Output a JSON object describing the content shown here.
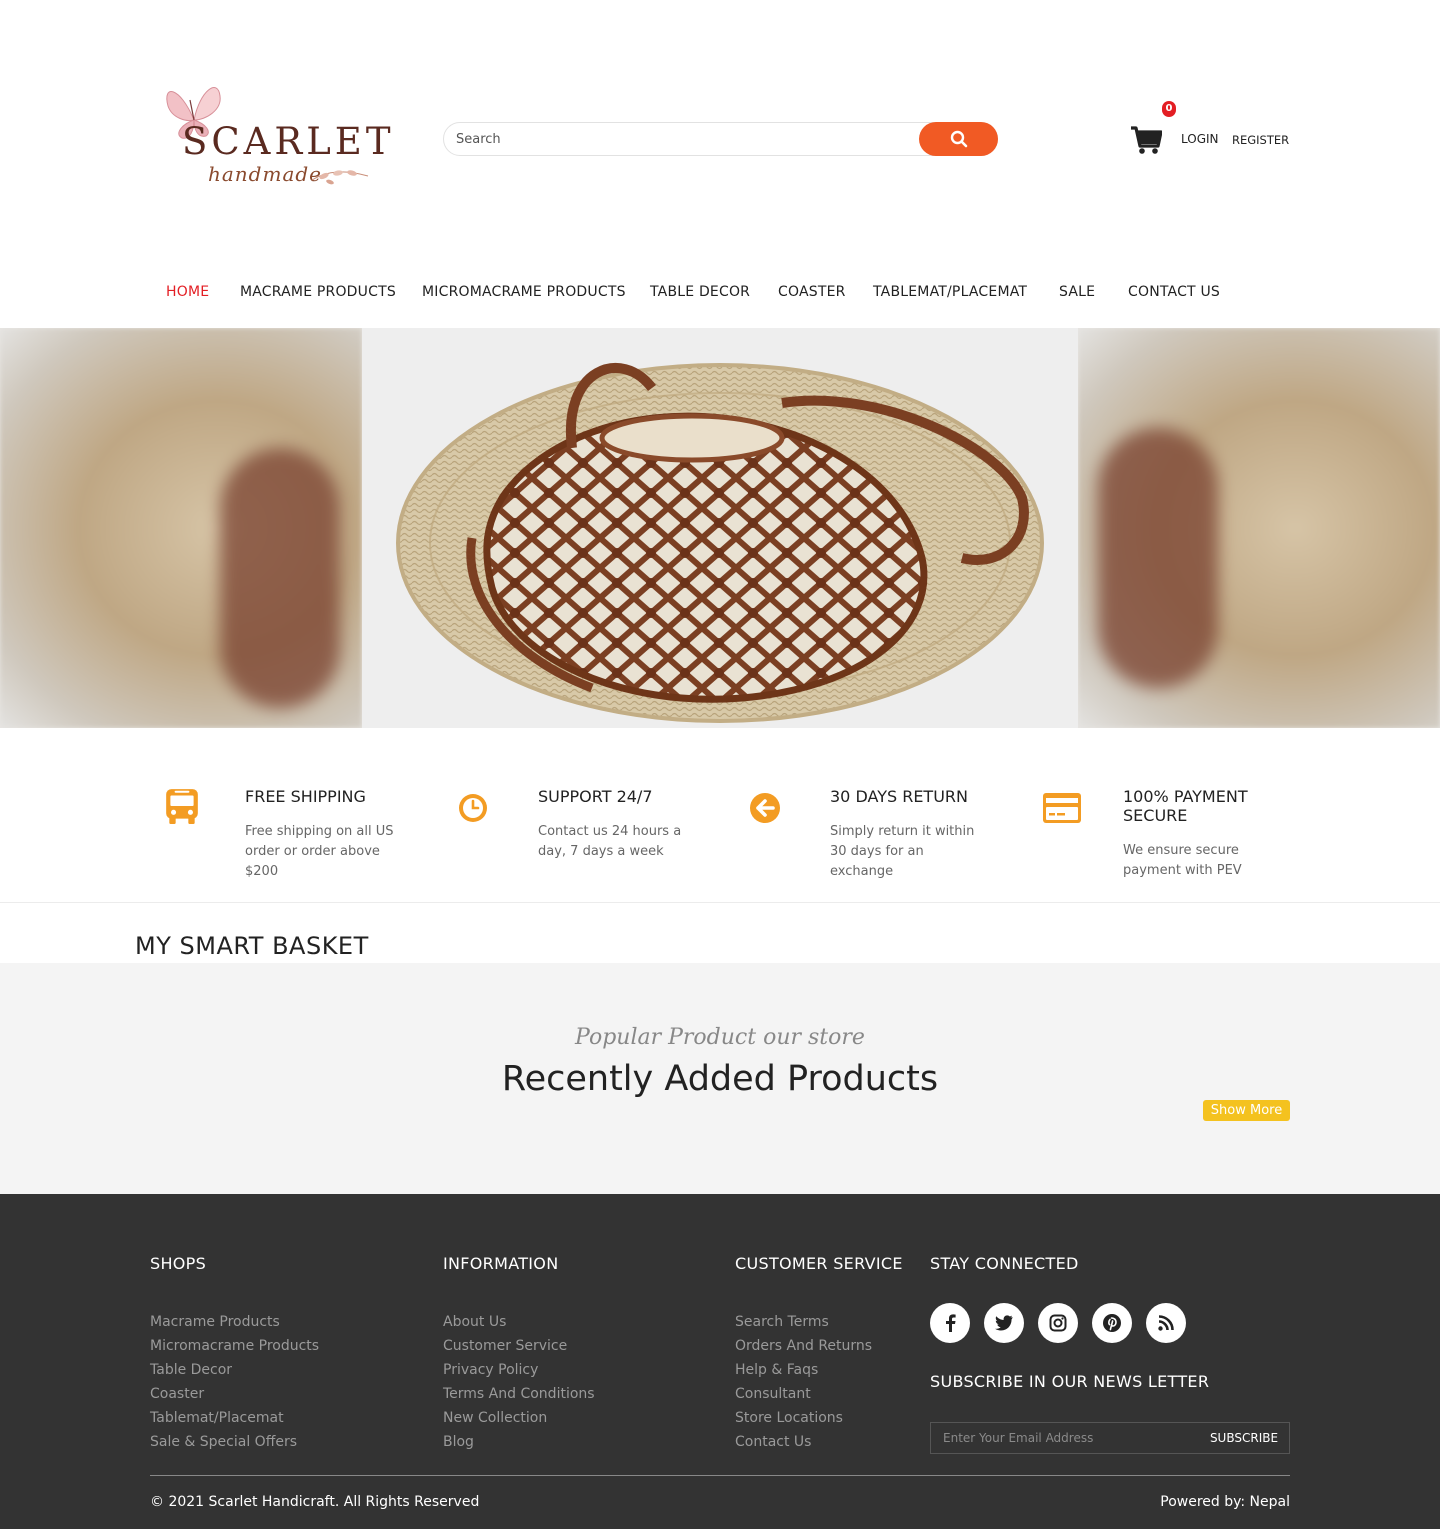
{
  "header": {
    "logo": {
      "brand": "SCARLET",
      "script": "handmade"
    },
    "search": {
      "placeholder": "Search"
    },
    "cart": {
      "count": "0"
    },
    "login_label": "LOGIN",
    "register_label": "REGISTER"
  },
  "nav": {
    "items": [
      {
        "label": "HOME"
      },
      {
        "label": "MACRAME PRODUCTS"
      },
      {
        "label": "MICROMACRAME PRODUCTS"
      },
      {
        "label": "TABLE DECOR"
      },
      {
        "label": "COASTER"
      },
      {
        "label": "TABLEMAT/PLACEMAT"
      },
      {
        "label": "SALE"
      },
      {
        "label": "CONTACT US"
      }
    ]
  },
  "features": [
    {
      "title": "FREE SHIPPING",
      "desc": "Free shipping on all US order or order above $200",
      "icon": "bus-icon"
    },
    {
      "title": "SUPPORT 24/7",
      "desc": "Contact us 24 hours a day, 7 days a week",
      "icon": "clock-icon"
    },
    {
      "title": "30 DAYS RETURN",
      "desc": "Simply return it within 30 days for an exchange",
      "icon": "arrow-left-circle-icon"
    },
    {
      "title": "100% PAYMENT SECURE",
      "desc": "We ensure secure payment with PEV",
      "icon": "credit-card-icon"
    }
  ],
  "colors": {
    "accent": "#f15a24",
    "feature_icon": "#f39c23",
    "active_nav": "#e31e24",
    "show_more": "#f4c21f",
    "footer_bg": "#333333"
  },
  "basket": {
    "title": "MY SMART BASKET"
  },
  "recent": {
    "subtitle": "Popular Product our store",
    "title": "Recently Added Products",
    "show_more": "Show More"
  },
  "footer": {
    "shops": {
      "title": "SHOPS",
      "links": [
        "Macrame Products",
        "Micromacrame Products",
        "Table Decor",
        "Coaster",
        "Tablemat/Placemat",
        "Sale & Special Offers"
      ]
    },
    "information": {
      "title": "INFORMATION",
      "links": [
        "About Us",
        "Customer Service",
        "Privacy Policy",
        "Terms And Conditions",
        "New Collection",
        "Blog"
      ]
    },
    "customer_service": {
      "title": "CUSTOMER SERVICE",
      "links": [
        "Search Terms",
        "Orders And Returns",
        "Help & Faqs",
        "Consultant",
        "Store Locations",
        "Contact Us"
      ]
    },
    "stay_connected": {
      "title": "STAY CONNECTED",
      "social": [
        "facebook-icon",
        "twitter-icon",
        "instagram-icon",
        "pinterest-icon",
        "rss-icon"
      ]
    },
    "newsletter": {
      "title": "SUBSCRIBE IN OUR NEWS LETTER",
      "placeholder": "Enter Your Email Address",
      "button": "SUBSCRIBE"
    },
    "copyright": "© 2021 Scarlet Handicraft. All Rights Reserved",
    "powered": "Powered by: Nepal"
  }
}
